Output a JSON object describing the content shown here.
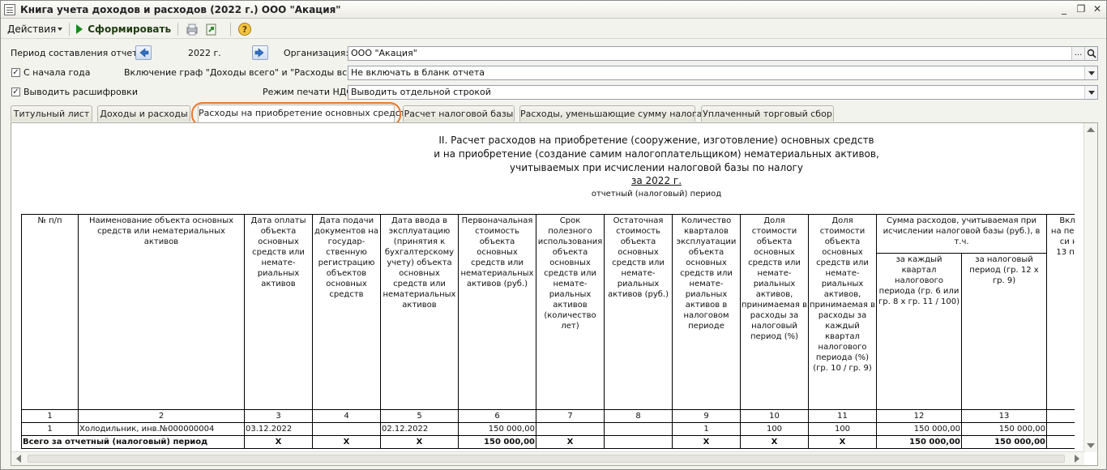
{
  "window": {
    "title": "Книга учета доходов и расходов (2022 г.) ООО \"Акация\"",
    "min": "_",
    "restore": "❐",
    "close": "✕"
  },
  "toolbar": {
    "actions_label": "Действия",
    "generate_label": "Сформировать",
    "help_glyph": "?"
  },
  "form": {
    "period_label": "Период составления отчета:",
    "period_value": "2022 г.",
    "org_label": "Организация:",
    "org_value": "ООО \"Акация\"",
    "from_start_label": "С начала года",
    "from_start_checked": true,
    "include_label": "Включение граф \"Доходы всего\" и \"Расходы всего\":",
    "include_value": "Не включать в бланк отчета",
    "decode_label": "Выводить расшифровки",
    "decode_checked": true,
    "vat_label": "Режим печати НДС:",
    "vat_value": "Выводить отдельной строкой",
    "check_glyph": "✓",
    "dots": "...",
    "search_glyph": "⌕"
  },
  "tabs": [
    {
      "label": "Титульный лист",
      "active": false
    },
    {
      "label": "Доходы и расходы",
      "active": false
    },
    {
      "label": "Расходы на приобретение основных средств",
      "active": true
    },
    {
      "label": "Расчет налоговой базы",
      "active": false
    },
    {
      "label": "Расходы, уменьшающие сумму налога",
      "active": false
    },
    {
      "label": "Уплаченный торговый сбор",
      "active": false
    }
  ],
  "report": {
    "title_line1": "II. Расчет расходов на приобретение (сооружение, изготовление) основных средств",
    "title_line2": "и на приобретение (создание самим налогоплательщиком) нематериальных активов,",
    "title_line3": "учитываемых при исчислении налоговой базы по налогу",
    "period": "за 2022 г.",
    "period_caption": "отчетный (налоговый) период",
    "headers": {
      "c1": "№ п/п",
      "c2": "Наименование объекта основных средств или нематериальных активов",
      "c3": "Дата оплаты объекта основных средств или немате-риальных активов",
      "c4": "Дата подачи документов на государ-ственную регистрацию объектов основных средств",
      "c5": "Дата ввода в эксплуатацию (принятия к бухгалтерскому учету) объекта основных средств или нематериальных активов",
      "c6": "Первоначальная стоимость объекта основных средств или нематериальных активов (руб.)",
      "c7": "Срок полезного использования объекта основных средств или немате-риальных активов (количество лет)",
      "c8": "Остаточная стоимость объекта основных средств или немате-риальных активов (руб.)",
      "c9": "Количество кварталов эксплуатации объекта основных средств или немате-риальных активов в налоговом периоде",
      "c10": "Доля стоимости объекта основных средств или немате-риальных активов, принимаемая в расходы за налоговый период (%)",
      "c11": "Доля стоимости объекта основных средств или немате-риальных активов, принимаемая в расходы за каждый квартал налогового периода (%) (гр. 10 / гр. 9)",
      "c12_13_group": "Сумма расходов, учитываемая при исчислении налоговой базы (руб.), в т.ч.",
      "c12": "за каждый квартал налогового периода (гр. 6 или гр. 8 х гр. 11 / 100)",
      "c13": "за налоговый период (гр. 12 х гр. 9)",
      "c14": "Вкл рас пре на пе при упр си нало (гр. 13 пре на пе"
    },
    "numbers": [
      "1",
      "2",
      "3",
      "4",
      "5",
      "6",
      "7",
      "8",
      "9",
      "10",
      "11",
      "12",
      "13",
      ""
    ],
    "rows": [
      {
        "c1": "1",
        "c2": "Холодильник, инв.№000000004",
        "c3": "03.12.2022",
        "c4": "",
        "c5": "02.12.2022",
        "c6": "150 000,00",
        "c7": "",
        "c8": "",
        "c9": "1",
        "c10": "100",
        "c11": "100",
        "c12": "150 000,00",
        "c13": "150 000,00",
        "c14": ""
      }
    ],
    "total": {
      "label": "Всего за отчетный  (налоговый) период",
      "c3": "X",
      "c4": "X",
      "c5": "X",
      "c6": "150 000,00",
      "c7": "X",
      "c8": "",
      "c9": "X",
      "c10": "X",
      "c11": "X",
      "c12": "150 000,00",
      "c13": "150 000,00",
      "c14": ""
    }
  }
}
